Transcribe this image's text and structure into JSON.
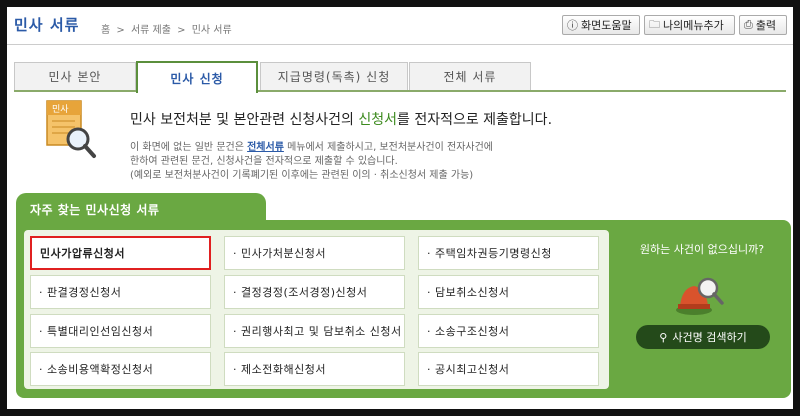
{
  "header": {
    "title": "민사 서류",
    "breadcrumb": [
      "홈",
      ">",
      "서류 제출",
      ">",
      "민사 서류"
    ],
    "help_label": "화면도움말",
    "mymenu_label": "나의메뉴추가",
    "print_label": "출력"
  },
  "tabs": [
    "민사 본안",
    "민사 신청",
    "지급명령(독촉) 신청",
    "전체 서류"
  ],
  "active_tab": "민사 신청",
  "intro": {
    "icon_label": "민사",
    "title_prefix": "민사 보전처분 및 본안관련 신청사건의 ",
    "title_highlight": "신청서",
    "title_suffix": "를 전자적으로 제출합니다.",
    "line1_prefix": "이 화면에 없는 일반 문건은 ",
    "line1_link": "전체서류",
    "line1_suffix": " 메뉴에서 제출하시고, 보전처분사건이 전자사건에",
    "line2": "한하여 관련된 문건, 신청사건을 전자적으로 제출할 수 있습니다.",
    "line3": "(예외로 보전처분사건이 기록폐기된 이후에는 관련된 이의 · 취소신청서 제출 가능)"
  },
  "panel": {
    "title": "자주 찾는 민사신청 서류",
    "items": [
      "민사가압류신청서",
      "· 민사가처분신청서",
      "· 주택임차권등기명령신청",
      "· 판결경정신청서",
      "· 결정경정(조서경정)신청서",
      "· 담보취소신청서",
      "· 특별대리인선임신청서",
      "· 권리행사최고 및 담보취소 신청서",
      "· 소송구조신청서",
      "· 소송비용액확정신청서",
      "· 제소전화해신청서",
      "· 공시최고신청서"
    ],
    "side_question": "원하는 사건이 없으십니까?",
    "search_label": "사건명 검색하기"
  },
  "colors": {
    "accent_blue": "#2b5aa7",
    "panel_green": "#6aa842",
    "highlight_red": "#e02020"
  }
}
